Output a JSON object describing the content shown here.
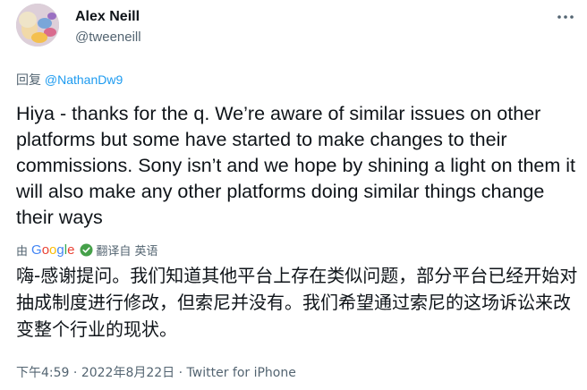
{
  "author": {
    "name": "Alex Neill",
    "handle": "@tweeneill"
  },
  "reply": {
    "prefix": "回复",
    "mention": "@NathanDw9"
  },
  "tweet": {
    "text_en": "Hiya - thanks for the q. We’re aware of similar issues on other platforms but some have started to make changes to their commissions. Sony isn’t and we hope by shining a light on them it will also make any other platforms doing similar things change their ways",
    "text_zh": "嗨-感谢提问。我们知道其他平台上存在类似问题，部分平台已经开始对抽成制度进行修改，但索尼并没有。我们希望通过索尼的这场诉讼来改变整个行业的现状。"
  },
  "translation": {
    "by_label": "由",
    "google_letters": [
      "G",
      "o",
      "o",
      "g",
      "l",
      "e"
    ],
    "google_colors": [
      "#4285f4",
      "#ea4335",
      "#fbbc05",
      "#4285f4",
      "#34a853",
      "#ea4335"
    ],
    "translated_label": "翻译自 英语"
  },
  "meta": {
    "time": "下午4:59",
    "date": "2022年8月22日",
    "separator": "·",
    "source": "Twitter for iPhone"
  },
  "colors": {
    "link": "#1d9bf0",
    "secondary": "#536471",
    "text": "#0f1419",
    "verified": "#45a049"
  },
  "icons": {
    "more": "more-horizontal-icon",
    "verified": "check-badge-icon"
  }
}
